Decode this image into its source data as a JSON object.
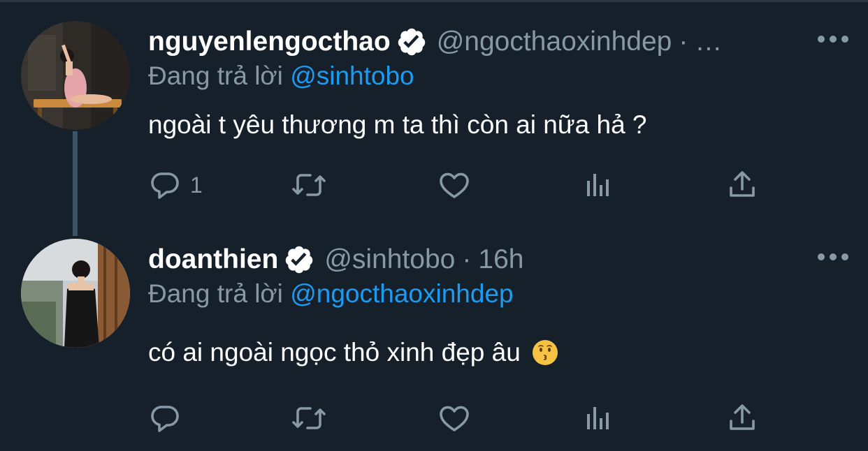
{
  "colors": {
    "background": "#15202b",
    "text": "#ffffff",
    "muted": "#8899a6",
    "link": "#1d9bf0",
    "thread_line": "#3d5466"
  },
  "tweets": [
    {
      "display_name": "nguyenlengocthao",
      "verified": true,
      "handle": "@ngocthaoxinhdep",
      "separator": "·",
      "time": "…",
      "reply_prefix": "Đang trả lời",
      "reply_to": "@sinhtobo",
      "text": "ngoài t yêu thương m ta thì còn ai nữa hả ?",
      "emoji": "",
      "reply_count": "1",
      "icons": [
        "avatar",
        "verified-badge-icon",
        "more-options-icon",
        "reply-icon",
        "retweet-icon",
        "like-icon",
        "analytics-icon",
        "share-icon"
      ]
    },
    {
      "display_name": "doanthien",
      "verified": true,
      "handle": "@sinhtobo",
      "separator": "·",
      "time": "16h",
      "reply_prefix": "Đang trả lời",
      "reply_to": "@ngocthaoxinhdep",
      "text": "có ai ngoài ngọc thỏ xinh đẹp âu",
      "emoji": "kissing-face-emoji",
      "reply_count": "",
      "icons": [
        "avatar",
        "verified-badge-icon",
        "more-options-icon",
        "reply-icon",
        "retweet-icon",
        "like-icon",
        "analytics-icon",
        "share-icon"
      ]
    }
  ]
}
